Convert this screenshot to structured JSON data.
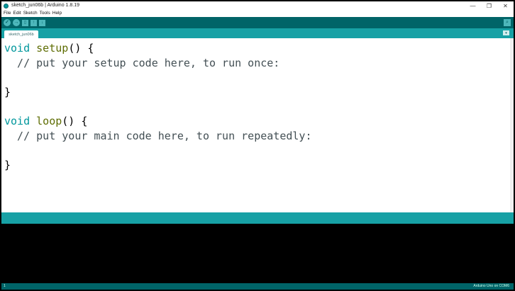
{
  "window": {
    "title": "sketch_jun06b | Arduino 1.8.19",
    "minimize": "—",
    "maximize": "❐",
    "close": "✕"
  },
  "menu": [
    "File",
    "Edit",
    "Sketch",
    "Tools",
    "Help"
  ],
  "toolbar": {
    "verify": "✓",
    "upload": "→",
    "new": "▯",
    "open": "↑",
    "save": "↓",
    "serial_monitor": "⌕"
  },
  "tabs": [
    {
      "label": "sketch_jun06b"
    }
  ],
  "tab_menu": "▾",
  "code": {
    "l1_type": "void",
    "l1_func": "setup",
    "l1_rest": "() {",
    "l2": "  // put your setup code here, to run once:",
    "l4": "}",
    "l6_type": "void",
    "l6_func": "loop",
    "l6_rest": "() {",
    "l7": "  // put your main code here, to run repeatedly:",
    "l9": "}"
  },
  "footer": {
    "line_number": "1",
    "board": "Arduino Uno on COM6"
  }
}
